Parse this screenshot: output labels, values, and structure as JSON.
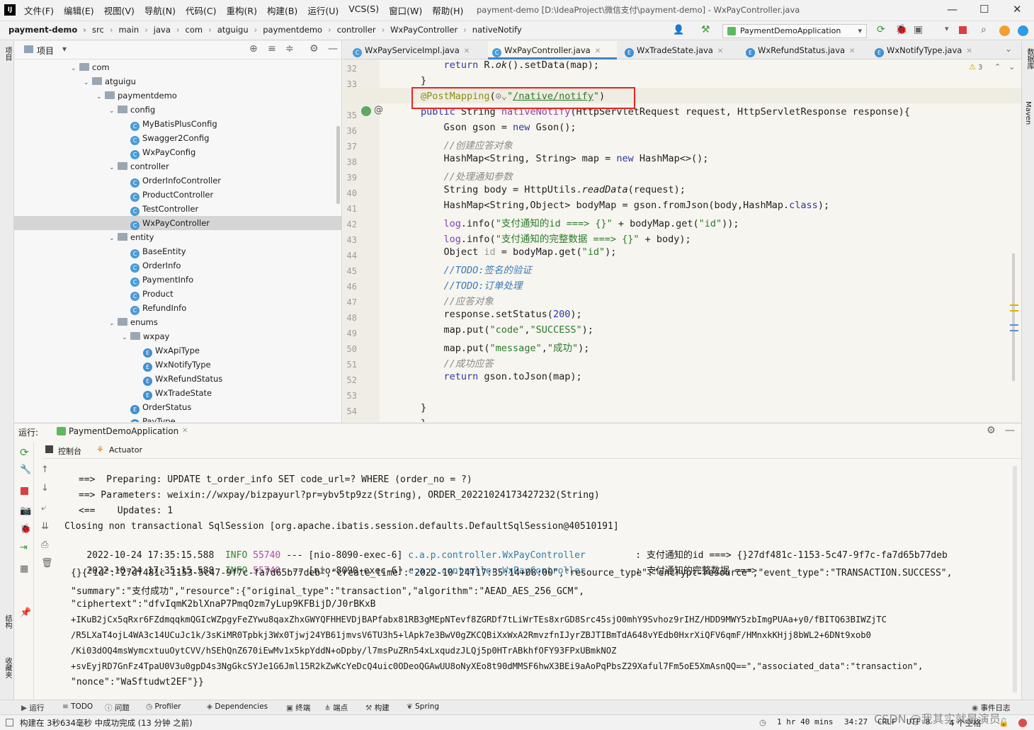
{
  "window": {
    "title": "payment-demo [D:\\IdeaProject\\微信支付\\payment-demo] - WxPayController.java",
    "logo": "IJ",
    "menu": [
      "文件(F)",
      "编辑(E)",
      "视图(V)",
      "导航(N)",
      "代码(C)",
      "重构(R)",
      "构建(B)",
      "运行(U)",
      "VCS(S)",
      "窗口(W)",
      "帮助(H)"
    ]
  },
  "breadcrumb": [
    "payment-demo",
    "src",
    "main",
    "java",
    "com",
    "atguigu",
    "paymentdemo",
    "controller",
    "WxPayController",
    "nativeNotify"
  ],
  "run_config": "PaymentDemoApplication",
  "project": {
    "title": "项目",
    "tree": [
      {
        "label": "com",
        "type": "folder",
        "arrow": "v"
      },
      {
        "label": "atguigu",
        "type": "folder",
        "arrow": "v"
      },
      {
        "label": "paymentdemo",
        "type": "folder",
        "arrow": "v"
      },
      {
        "label": "config",
        "type": "folder",
        "arrow": "v"
      },
      {
        "label": "MyBatisPlusConfig",
        "type": "class"
      },
      {
        "label": "Swagger2Config",
        "type": "class"
      },
      {
        "label": "WxPayConfig",
        "type": "class"
      },
      {
        "label": "controller",
        "type": "folder",
        "arrow": "v"
      },
      {
        "label": "OrderInfoController",
        "type": "class"
      },
      {
        "label": "ProductController",
        "type": "class"
      },
      {
        "label": "TestController",
        "type": "class"
      },
      {
        "label": "WxPayController",
        "type": "class",
        "selected": true
      },
      {
        "label": "entity",
        "type": "folder",
        "arrow": "v"
      },
      {
        "label": "BaseEntity",
        "type": "class"
      },
      {
        "label": "OrderInfo",
        "type": "class"
      },
      {
        "label": "PaymentInfo",
        "type": "class"
      },
      {
        "label": "Product",
        "type": "class"
      },
      {
        "label": "RefundInfo",
        "type": "class"
      },
      {
        "label": "enums",
        "type": "folder",
        "arrow": "v"
      },
      {
        "label": "wxpay",
        "type": "folder",
        "arrow": "v"
      },
      {
        "label": "WxApiType",
        "type": "enum"
      },
      {
        "label": "WxNotifyType",
        "type": "enum"
      },
      {
        "label": "WxRefundStatus",
        "type": "enum"
      },
      {
        "label": "WxTradeState",
        "type": "enum"
      },
      {
        "label": "OrderStatus",
        "type": "enum"
      },
      {
        "label": "PayType",
        "type": "enum"
      }
    ]
  },
  "editor": {
    "tabs": [
      "WxPayServiceImpl.java",
      "WxPayController.java",
      "WxTradeState.java",
      "WxRefundStatus.java",
      "WxNotifyType.java"
    ],
    "active_tab": 1,
    "warnings": "3",
    "line_numbers": [
      "32",
      "33",
      "34",
      "35",
      "36",
      "37",
      "38",
      "39",
      "40",
      "41",
      "42",
      "43",
      "44",
      "45",
      "46",
      "47",
      "48",
      "49",
      "50",
      "51",
      "52",
      "53",
      "54",
      "55"
    ]
  },
  "run": {
    "label": "运行:",
    "app": "PaymentDemoApplication",
    "sub_tabs": [
      "控制台",
      "Actuator"
    ],
    "console": {
      "l0": "==>  Preparing: UPDATE t_order_info SET code_url=? WHERE (order_no = ?)",
      "l1": "==> Parameters: weixin://wxpay/bizpayurl?pr=ybv5tp9zz(String), ORDER_20221024173427232(String)",
      "l2": "<==    Updates: 1",
      "l3": "Closing non transactional SqlSession [org.apache.ibatis.session.defaults.DefaultSqlSession@40510191]",
      "log1": {
        "ts": "2022-10-24 17:35:15.588",
        "level": "INFO",
        "pid": "55740",
        "thread": "--- [nio-8090-exec-6]",
        "cls": "c.a.p.controller.WxPayController",
        "msg": ": 支付通知的id ===> {}27df481c-1153-5c47-9f7c-fa7d65b77deb"
      },
      "log2": {
        "ts": "2022-10-24 17:35:15.588",
        "level": "INFO",
        "pid": "55740",
        "thread": "--- [nio-8090-exec-6]",
        "cls": "c.a.p.controller.WxPayController",
        "msg": ": 支付通知的完整数据 ===>"
      },
      "j0": "{}{\"id\":\"27df481c-1153-5c47-9f7c-fa7d65b77deb\",\"create_time\":\"2022-10-24T17:35:14+08:00\",\"resource_type\":\"encrypt-resource\",\"event_type\":\"TRANSACTION.SUCCESS\",",
      "j1": "\"summary\":\"支付成功\",\"resource\":{\"original_type\":\"transaction\",\"algorithm\":\"AEAD_AES_256_GCM\",",
      "j2": "\"ciphertext\":\"dfvIqmK2blXnaP7PmqOzm7yLup9KFBijD/J0rBKxB",
      "j3": "+IKuB2jCx5qRxr6FZdmqqkmQGIcWZpgyFeZYwu8qaxZhxGWYQFHHEVDjBAPfabx81RB3gMEpNTevf8ZGRDf7tLiWrTEs8xrGD8Src45sjO0mhY9Svhoz9rIHZ/HDD9MWY5zbImgPUAa+y0/fBITQ63BIWZjTC",
      "j4": "/R5LXaT4ojL4WA3c14UCuJc1k/3sKiMR0Tpbkj3Wx0Tjwj24YB61jmvsV6TU3h5+lApk7e3BwV0gZKCQBiXxWxA2RmvzfnIJyrZBJTIBmTdA648vYEdb0HxrXiQFV6qmF/HMnxkKHjj8bWL2+6DNt9xob0",
      "j5": "/Ki03dOQ4msWymcxtuuOytCVV/hSEhQnZ670iEwMv1x5kpYddN+oDpby/l7msPuZRn54xLxqudzJLQj5p0HTrABkhfOFY93FPxUBmkNOZ",
      "j6": "+svEyjRD7GnFz4TpaU0V3u0gpD4s3NgGkcSYJe1G6Jml15R2kZwKcYeDcQ4uic0ODeoQGAwUU8oNyXEo8t90dMMSF6hwX3BEi9aAoPqPbsZ29Xaful7Fm5oE5XmAsnQQ==\",\"associated_data\":\"transaction\",",
      "j7": "\"nonce\":\"WaSftudwt2EF\"}}"
    }
  },
  "bottom_tools": [
    "运行",
    "TODO",
    "问题",
    "Profiler",
    "Dependencies",
    "终端",
    "端点",
    "构建",
    "Spring",
    "事件日志"
  ],
  "status": {
    "build": "构建在 3秒634毫秒 中成功完成 (13 分钟 之前)",
    "time": "1 hr 40 mins",
    "position": "34:27",
    "line_sep": "CRLF",
    "encoding": "UTF-8",
    "indent": "4 个空格",
    "watermark": "CSDN @我其实就是演员"
  },
  "left_strip_labels": [
    "项目",
    "结构",
    "收藏夹"
  ],
  "right_strip_labels": [
    "数据库",
    "Maven"
  ]
}
